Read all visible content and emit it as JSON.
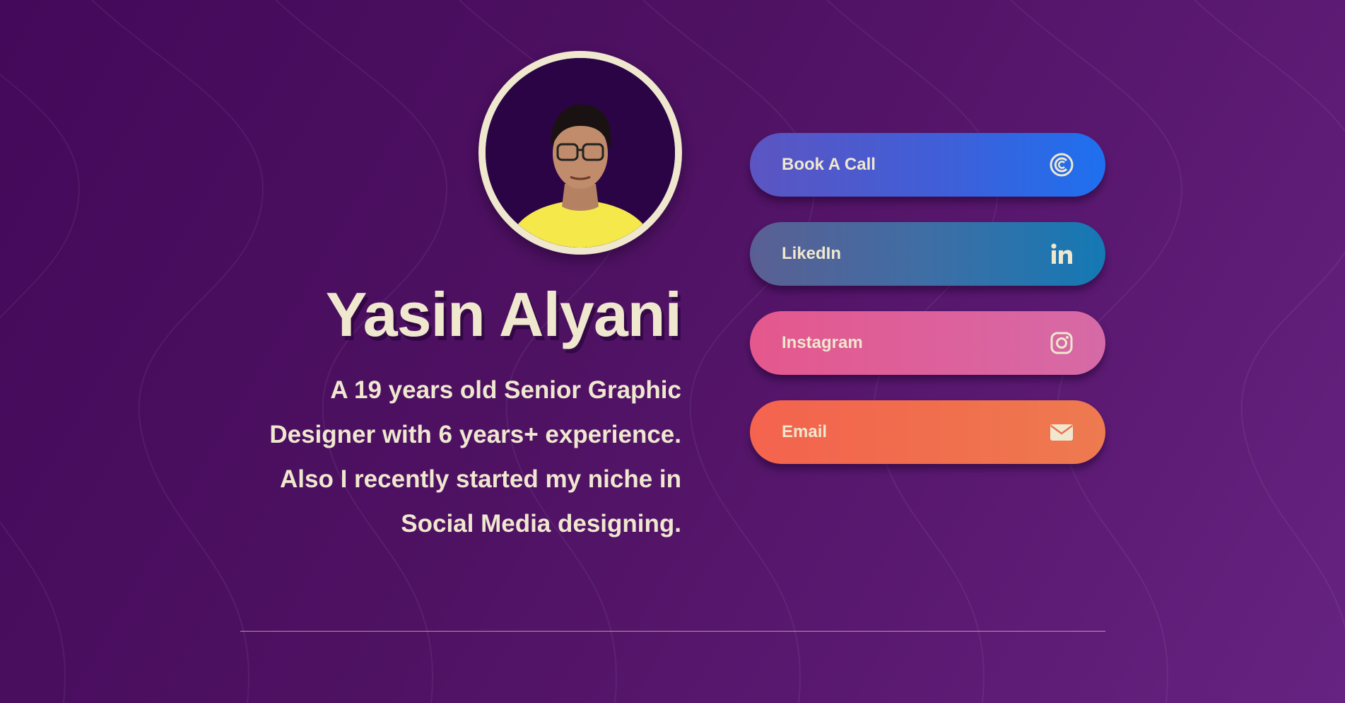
{
  "profile": {
    "name": "Yasin Alyani",
    "bio": "A 19 years old Senior Graphic Designer with 6 years+ experience. Also I recently started my niche in Social Media designing."
  },
  "links": [
    {
      "label": "Book A Call",
      "icon": "calendly-icon"
    },
    {
      "label": "LikedIn",
      "icon": "linkedin-icon"
    },
    {
      "label": "Instagram",
      "icon": "instagram-icon"
    },
    {
      "label": "Email",
      "icon": "mail-icon"
    }
  ],
  "colors": {
    "background": "#4f1263",
    "text": "#efe8cf",
    "book_call": "#1e70ef",
    "linkedin": "#1479b4",
    "instagram": "#e4588d",
    "email": "#f4634e"
  }
}
